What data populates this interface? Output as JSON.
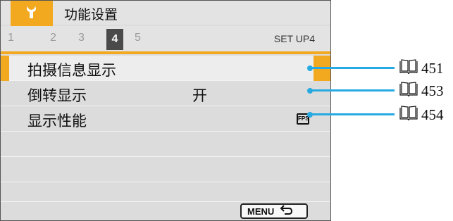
{
  "header": {
    "category_icon": "wrench-icon",
    "title": "功能设置",
    "tabs": [
      "1",
      "2",
      "3",
      "4",
      "5"
    ],
    "active_tab": "4",
    "tab_label": "SET UP4"
  },
  "menu": {
    "items": [
      {
        "label": "拍摄信息显示",
        "value": ""
      },
      {
        "label": "倒转显示",
        "value": "开"
      },
      {
        "label": "显示性能",
        "value": "FPS",
        "value_icon": "fps-icon"
      }
    ]
  },
  "footer": {
    "menu_label": "MENU",
    "back_icon": "return-arrow-icon"
  },
  "references": [
    {
      "icon": "book-icon",
      "page": "451"
    },
    {
      "icon": "book-icon",
      "page": "453"
    },
    {
      "icon": "book-icon",
      "page": "454"
    }
  ],
  "colors": {
    "accent": "#f2a81f",
    "callout": "#27a9e1",
    "screen_bg": "#dcdcdc"
  }
}
